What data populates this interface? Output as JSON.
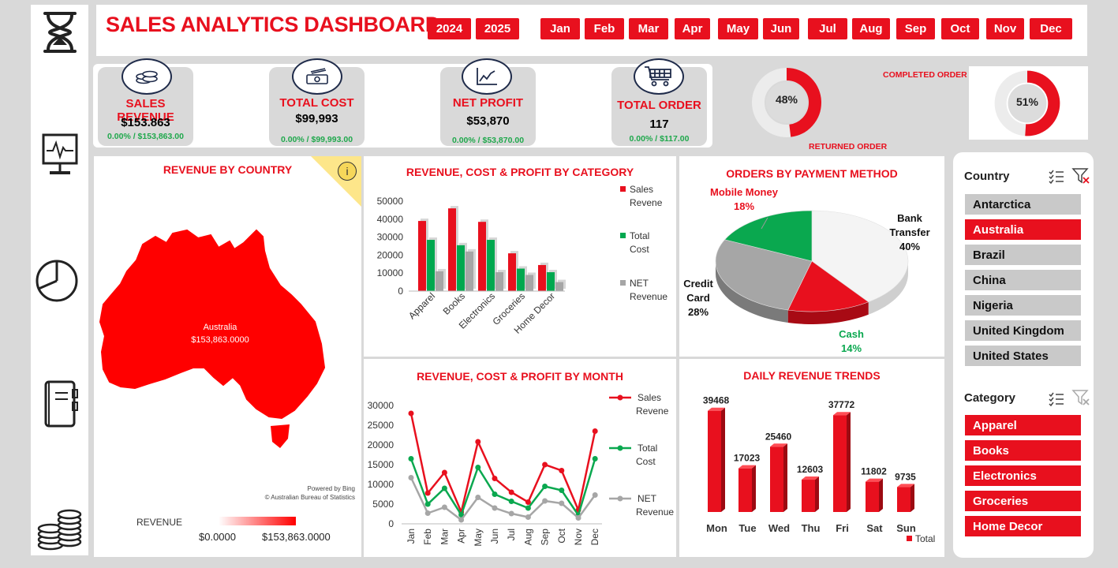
{
  "header": {
    "title": "SALES ANALYTICS DASHBOARD",
    "years": [
      "2024",
      "2025"
    ],
    "months": [
      "Jan",
      "Feb",
      "Mar",
      "Apr",
      "May",
      "Jun",
      "Jul",
      "Aug",
      "Sep",
      "Oct",
      "Nov",
      "Dec"
    ]
  },
  "sidebar": {
    "icons": [
      "hourglass-icon",
      "monitor-icon",
      "pie-chart-icon",
      "book-icon",
      "coins-icon"
    ]
  },
  "kpis": [
    {
      "label": "SALES REVENUE",
      "value": "$153.863",
      "sub": "0.00% / $153,863.00",
      "icon": "coins-icon"
    },
    {
      "label": "TOTAL COST",
      "value": "$99,993",
      "sub": "0.00% / $99,993.00",
      "icon": "cash-icon"
    },
    {
      "label": "NET PROFIT",
      "value": "$53,870",
      "sub": "0.00% / $53,870.00",
      "icon": "line-chart-icon"
    },
    {
      "label": "TOTAL ORDER",
      "value": "117",
      "sub": "0.00% / $117.00",
      "icon": "cart-icon"
    }
  ],
  "donuts": {
    "returned": {
      "label": "RETURNED ORDER",
      "value_text": "48%",
      "value": 48
    },
    "completed": {
      "label": "COMPLETED ORDER",
      "value_text": "51%",
      "value": 51
    }
  },
  "map_panel": {
    "title": "REVENUE BY COUNTRY",
    "region_label": "Australia",
    "region_value": "$153,863.0000",
    "info_icon": "i",
    "attribution_1": "Powered by Bing",
    "attribution_2": "© Australian Bureau of Statistics",
    "legend_label": "REVENUE",
    "legend_min": "$0.0000",
    "legend_max": "$153,863.0000"
  },
  "colors": {
    "accent": "#e8101e",
    "green": "#00a84f",
    "gray": "#a6a6a6"
  },
  "chart_data": [
    {
      "type": "bar",
      "title": "REVENUE, COST & PROFIT BY CATEGORY",
      "categories": [
        "Apparel",
        "Books",
        "Electronics",
        "Groceries",
        "Home Decor"
      ],
      "series": [
        {
          "name": "Sales Revene",
          "values": [
            39000,
            46000,
            38500,
            21000,
            14500
          ]
        },
        {
          "name": "Total Cost",
          "values": [
            28500,
            25500,
            28500,
            12500,
            10500
          ]
        },
        {
          "name": "NET Revenue",
          "values": [
            11000,
            22000,
            10500,
            9000,
            5000
          ]
        }
      ],
      "yticks": [
        "0",
        "10000",
        "20000",
        "30000",
        "40000",
        "50000"
      ],
      "ylim": [
        0,
        50000
      ],
      "legend_position": "right"
    },
    {
      "type": "pie",
      "title": "ORDERS BY PAYMENT METHOD",
      "slices": [
        {
          "name": "Bank Transfer",
          "pct_text": "40%",
          "value": 40
        },
        {
          "name": "Cash",
          "pct_text": "14%",
          "value": 14
        },
        {
          "name": "Credit Card",
          "pct_text": "28%",
          "value": 28
        },
        {
          "name": "Mobile Money",
          "pct_text": "18%",
          "value": 18
        }
      ]
    },
    {
      "type": "line",
      "title": "REVENUE, COST & PROFIT BY MONTH",
      "x": [
        "Jan",
        "Feb",
        "Mar",
        "Apr",
        "May",
        "Jun",
        "Jul",
        "Aug",
        "Sep",
        "Oct",
        "Nov",
        "Dec"
      ],
      "series": [
        {
          "name": "Sales Revene",
          "values": [
            28000,
            7800,
            13000,
            3000,
            20800,
            11500,
            8000,
            5500,
            15000,
            13500,
            3500,
            23500
          ]
        },
        {
          "name": "Total Cost",
          "values": [
            16500,
            5000,
            9000,
            2300,
            14300,
            7500,
            5700,
            4000,
            9500,
            8500,
            2200,
            16500
          ]
        },
        {
          "name": "NET Revenue",
          "values": [
            11700,
            2700,
            4200,
            1000,
            6700,
            4000,
            2600,
            1700,
            5800,
            5200,
            1500,
            7300
          ]
        }
      ],
      "yticks": [
        "0",
        "5000",
        "10000",
        "15000",
        "20000",
        "25000",
        "30000"
      ],
      "ylim": [
        0,
        30000
      ],
      "legend_position": "right"
    },
    {
      "type": "bar",
      "title": "DAILY REVENUE TRENDS",
      "categories": [
        "Mon",
        "Tue",
        "Wed",
        "Thu",
        "Fri",
        "Sat",
        "Sun"
      ],
      "series": [
        {
          "name": "Total",
          "values": [
            39468,
            17023,
            25460,
            12603,
            37772,
            11802,
            9735
          ]
        }
      ],
      "data_labels": [
        "39468",
        "17023",
        "25460",
        "12603",
        "37772",
        "11802",
        "9735"
      ],
      "legend_position": "bottom-right"
    }
  ],
  "slicers": {
    "country": {
      "title": "Country",
      "items": [
        "Antarctica",
        "Australia",
        "Brazil",
        "China",
        "Nigeria",
        "United Kingdom",
        "United States"
      ],
      "selected": "Australia"
    },
    "category": {
      "title": "Category",
      "items": [
        "Apparel",
        "Books",
        "Electronics",
        "Groceries",
        "Home Decor"
      ]
    }
  }
}
